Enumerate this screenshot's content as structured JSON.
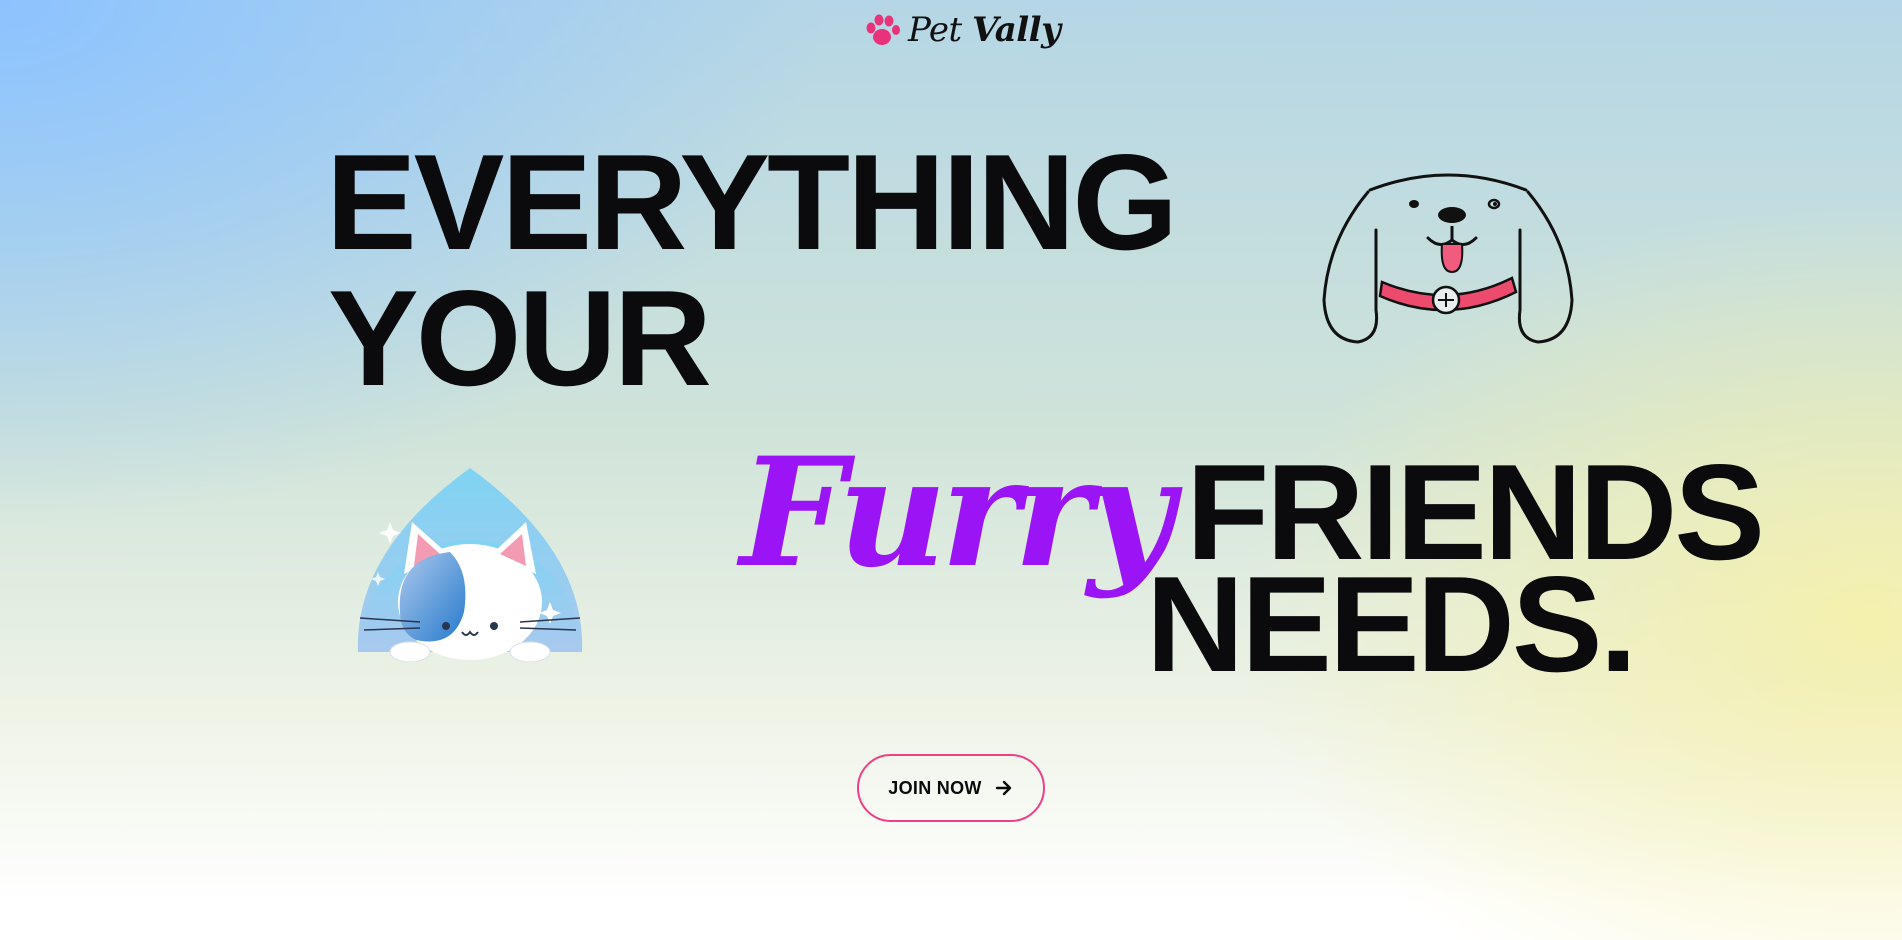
{
  "brand": {
    "name_light": "Pet",
    "name_bold": "Vally",
    "paw_color": "#e8337a"
  },
  "hero": {
    "line1": "EVERYTHING",
    "line2": "YOUR",
    "accent_word": "Furry",
    "line3_rest": "FRIENDS",
    "line4": "NEEDS.",
    "accent_color": "#9b14f5"
  },
  "cta": {
    "label": "JOIN NOW",
    "border_color": "#ef3f86",
    "icon": "arrow-right-icon"
  },
  "illustrations": {
    "dog": "dog-illustration",
    "cat": "cat-illustration"
  }
}
